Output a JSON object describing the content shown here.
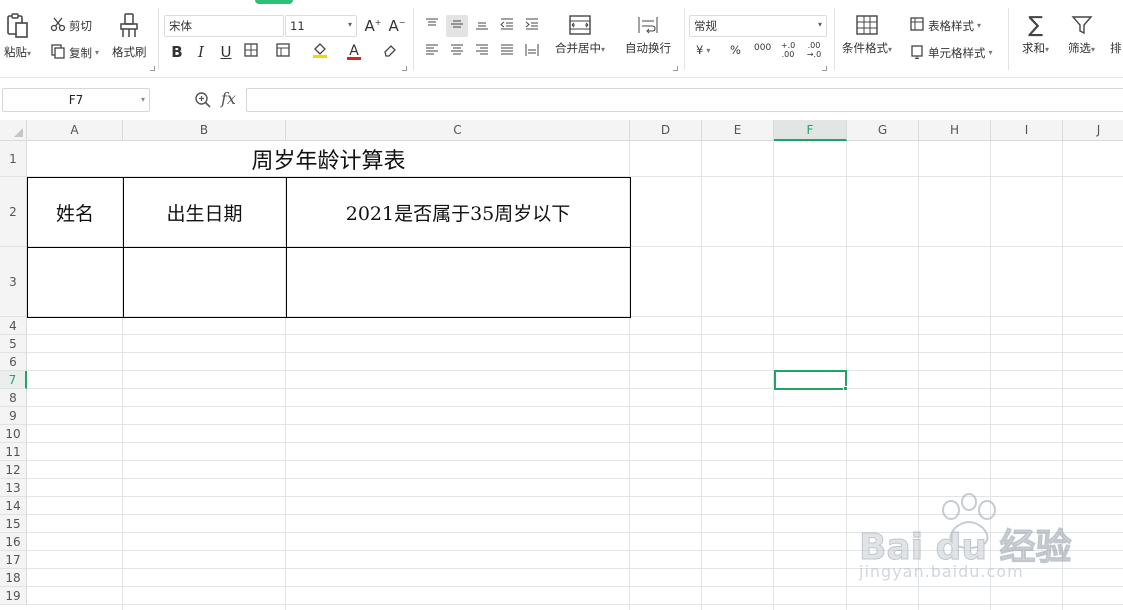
{
  "ribbon": {
    "clipboard": {
      "paste": "粘贴",
      "cut": "剪切",
      "copy": "复制",
      "format_painter": "格式刷"
    },
    "font": {
      "name": "宋体",
      "size": "11",
      "bold": "B",
      "italic": "I",
      "underline": "U",
      "font_color_glyph": "A"
    },
    "align": {
      "merge_center": "合并居中",
      "wrap_text": "自动换行"
    },
    "number": {
      "format": "常规",
      "currency": "¥",
      "percent": "%",
      "thousands": "000",
      "inc_decimal": "+.0 .00",
      "dec_decimal": ".00 →.0"
    },
    "styles": {
      "conditional_format": "条件格式",
      "table_style": "表格样式",
      "cell_style": "单元格样式"
    },
    "editing": {
      "sum": "求和",
      "filter": "筛选",
      "sort": "排"
    }
  },
  "formula_bar": {
    "cell_ref": "F7",
    "fx": "fx",
    "content": ""
  },
  "columns": [
    "A",
    "B",
    "C",
    "D",
    "E",
    "F",
    "G",
    "H",
    "I",
    "J"
  ],
  "selected_column": "F",
  "rows": [
    "1",
    "2",
    "3",
    "4",
    "5",
    "6",
    "7",
    "8",
    "9",
    "10",
    "11",
    "12",
    "13",
    "14",
    "15",
    "16",
    "17",
    "18",
    "19"
  ],
  "selected_row": "7",
  "sheet": {
    "title": "周岁年龄计算表",
    "headers": [
      "姓名",
      "出生日期",
      "2021是否属于35周岁以下"
    ]
  },
  "watermark": {
    "brand": "Bai du 经验",
    "url": "jingyan.baidu.com"
  },
  "colors": {
    "accent": "#21a366",
    "gridline": "#e2e5e8",
    "header_bg": "#f4f4f4"
  }
}
